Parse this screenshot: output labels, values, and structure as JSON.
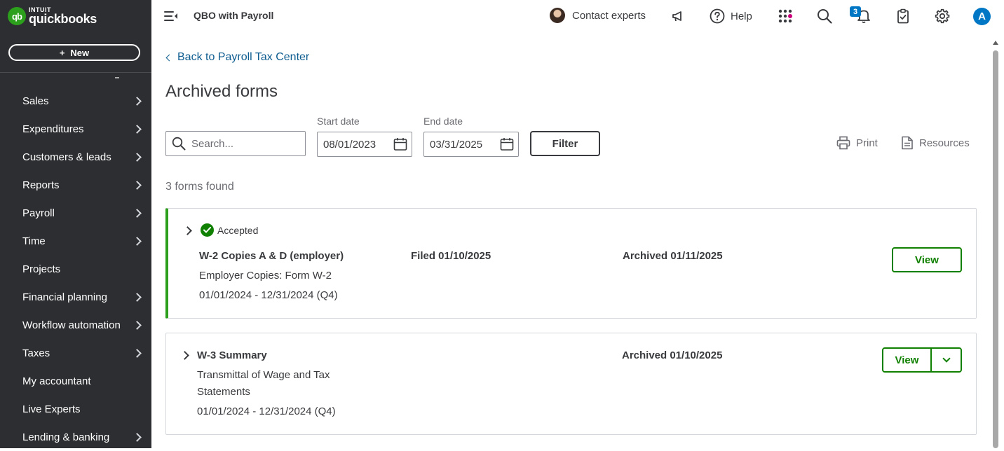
{
  "brand": {
    "intuit": "INTUIT",
    "product": "quickbooks",
    "logo_mark": "qb"
  },
  "sidebar": {
    "new_label": "New",
    "new_icon": "+",
    "items": [
      {
        "label": "Sales",
        "chevron": true
      },
      {
        "label": "Expenditures",
        "chevron": true
      },
      {
        "label": "Customers & leads",
        "chevron": true
      },
      {
        "label": "Reports",
        "chevron": true
      },
      {
        "label": "Payroll",
        "chevron": true
      },
      {
        "label": "Time",
        "chevron": true
      },
      {
        "label": "Projects",
        "chevron": false
      },
      {
        "label": "Financial planning",
        "chevron": true
      },
      {
        "label": "Workflow automation",
        "chevron": true
      },
      {
        "label": "Taxes",
        "chevron": true
      },
      {
        "label": "My accountant",
        "chevron": false
      },
      {
        "label": "Live Experts",
        "chevron": false
      },
      {
        "label": "Lending & banking",
        "chevron": true
      }
    ]
  },
  "topbar": {
    "company": "QBO with Payroll",
    "contact_label": "Contact experts",
    "help_label": "Help",
    "notification_count": "3",
    "user_initial": "A",
    "icons": [
      "menu-collapse-icon",
      "megaphone-icon",
      "help-icon",
      "apps-icon",
      "search-icon",
      "bell-icon",
      "clipboard-icon",
      "gear-icon"
    ]
  },
  "page": {
    "back_link": "Back to Payroll Tax Center",
    "title": "Archived forms",
    "search_placeholder": "Search...",
    "start_date_label": "Start date",
    "start_date": "08/01/2023",
    "end_date_label": "End date",
    "end_date": "03/31/2025",
    "filter_label": "Filter",
    "print_label": "Print",
    "resources_label": "Resources",
    "count_text": "3 forms found"
  },
  "forms": [
    {
      "status": "Accepted",
      "title": "W-2 Copies A & D (employer)",
      "description": "Employer Copies: Form W-2",
      "period": "01/01/2024 - 12/31/2024 (Q4)",
      "filed": "Filed 01/10/2025",
      "archived": "Archived 01/11/2025",
      "action": "View"
    },
    {
      "title": "W-3 Summary",
      "description_line1": "Transmittal of Wage and Tax",
      "description_line2": "Statements",
      "period": "01/01/2024 - 12/31/2024 (Q4)",
      "archived": "Archived 01/10/2025",
      "action": "View"
    }
  ],
  "colors": {
    "sidebar_bg": "#2d2e31",
    "brand_green": "#2ca01c",
    "action_green": "#108000",
    "link_blue": "#0d5c8f",
    "badge_blue": "#0077c5"
  }
}
